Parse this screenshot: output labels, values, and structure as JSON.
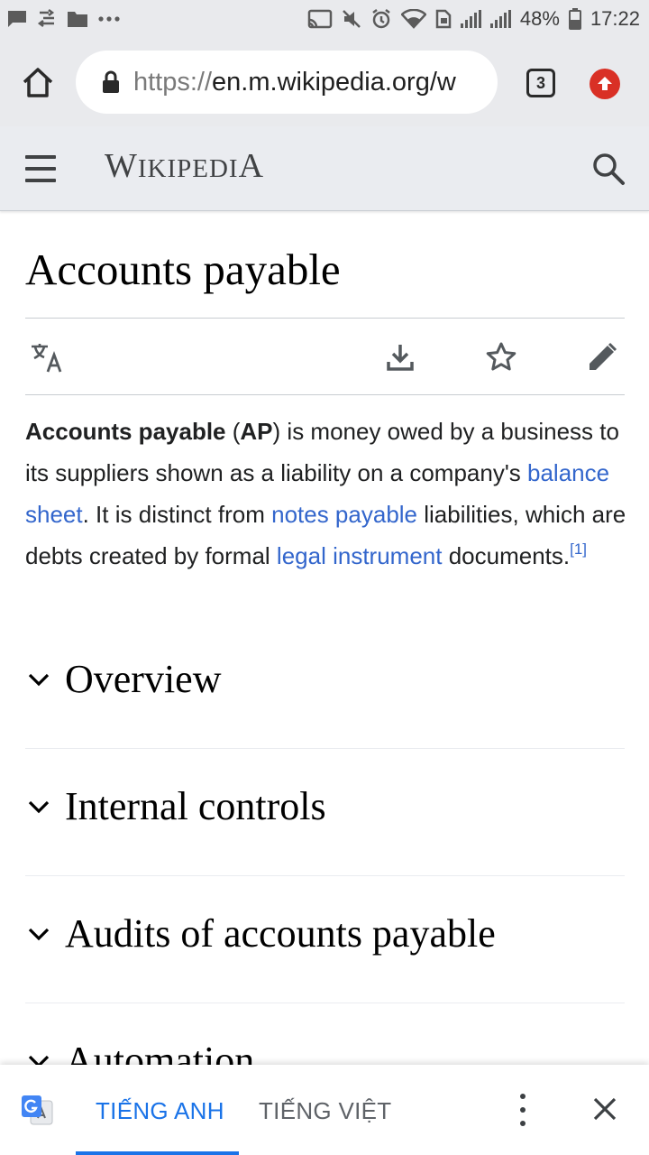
{
  "status_bar": {
    "battery_percent": "48%",
    "time": "17:22",
    "left_icons": [
      "message-icon",
      "usb-icon",
      "folder-icon",
      "more-dots-icon"
    ],
    "right_icons": [
      "cast-icon",
      "mute-icon",
      "alarm-icon",
      "wifi-icon",
      "sim-icon",
      "signal-icon",
      "signal-icon",
      "battery-icon"
    ]
  },
  "browser": {
    "url_scheme": "https://",
    "url_host": "en.m.wikipedia.org/w",
    "tab_count": "3"
  },
  "wiki_header": {
    "wordmark_first": "W",
    "wordmark_middle": "IKIPEDI",
    "wordmark_last": "A"
  },
  "article": {
    "title": "Accounts payable",
    "lead": {
      "term": "Accounts payable",
      "paren_open": " (",
      "abbr": "AP",
      "text1": ") is money owed by a business to its suppliers shown as a liability on a company's ",
      "link1": "balance sheet",
      "text2": ". It is distinct from ",
      "link2": "notes payable",
      "text3": " liabilities, which are debts created by formal ",
      "link3": "legal instrument",
      "text4": " documents.",
      "ref": "[1]"
    },
    "sections": [
      "Overview",
      "Internal controls",
      "Audits of accounts payable",
      "Automation"
    ]
  },
  "translate_bar": {
    "source_lang": "TIẾNG ANH",
    "target_lang": "TIẾNG VIỆT"
  },
  "colors": {
    "link": "#3366cc",
    "accent": "#1a73e8",
    "update_badge": "#d93025"
  }
}
